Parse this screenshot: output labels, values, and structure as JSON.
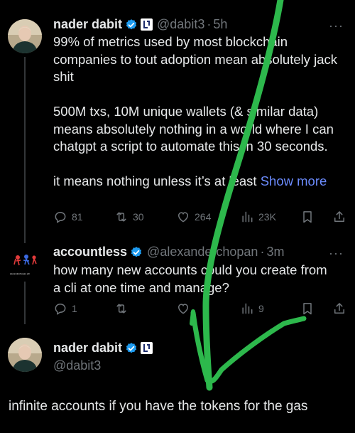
{
  "tweet1": {
    "name": "nader dabit",
    "handle": "@dabit3",
    "time": "5h",
    "more": "···",
    "paragraphs": [
      "99% of metrics used by most blockchain companies to tout adoption mean absolutely jack shit",
      "500M txs, 10M unique wallets (& similar data) means absolutely nothing in a world where I can chatgpt a script to automate this in 30 seconds.",
      "it means nothing unless it’s at least"
    ],
    "show_more": "Show more",
    "replies": "81",
    "reposts": "30",
    "likes": "264",
    "views": "23K"
  },
  "tweet2": {
    "name": "accountless",
    "handle": "@alexanderchopan",
    "time": "3m",
    "more": "···",
    "avatar_caption": "alexanderchopan.eth",
    "text": "how many new accounts could you create from a cli at one time and manage?",
    "replies": "1",
    "views": "9"
  },
  "tweet3": {
    "name": "nader dabit",
    "handle": "@dabit3",
    "text": "infinite accounts if you have the tokens for the gas"
  },
  "colors": {
    "background": "#000000",
    "text": "#e7e9ea",
    "muted": "#71767b",
    "link": "#6c8cff",
    "verified": "#1d9bf0",
    "scribble": "#2db84c"
  },
  "icons": [
    "verified-badge-icon",
    "affiliate-badge-icon",
    "reply-icon",
    "repost-icon",
    "like-icon",
    "views-icon",
    "bookmark-icon",
    "share-icon",
    "more-icon"
  ]
}
